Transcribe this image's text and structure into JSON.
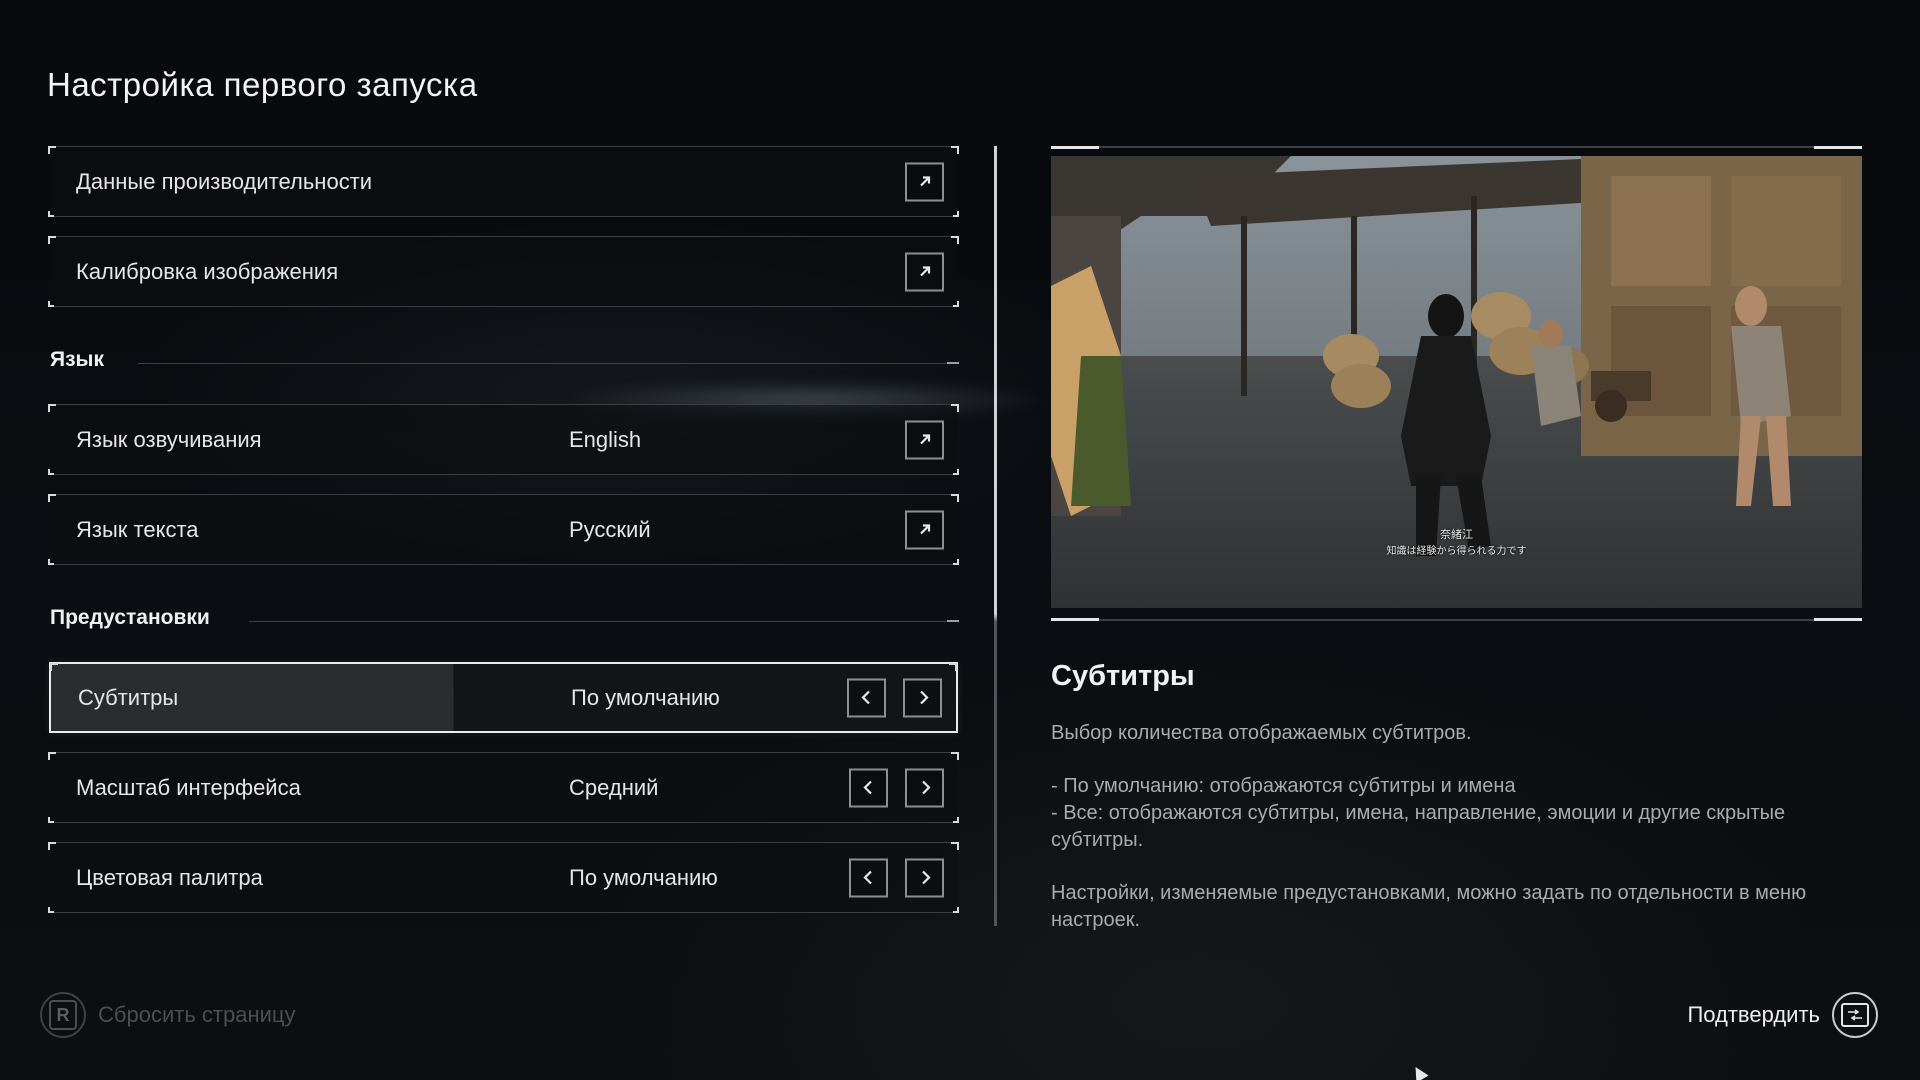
{
  "page": {
    "title": "Настройка первого запуска"
  },
  "rows_top": [
    {
      "label": "Данные производительности",
      "action_icon": "external-arrow-icon"
    },
    {
      "label": "Калибровка изображения",
      "action_icon": "external-arrow-icon"
    }
  ],
  "sections": {
    "language": "Язык",
    "presets": "Предустановки"
  },
  "language_rows": [
    {
      "label": "Язык озвучивания",
      "value": "English",
      "action_icon": "external-arrow-icon"
    },
    {
      "label": "Язык текста",
      "value": "Русский",
      "action_icon": "external-arrow-icon"
    }
  ],
  "preset_rows": [
    {
      "label": "Субтитры",
      "value": "По умолчанию",
      "selected": true
    },
    {
      "label": "Масштаб интерфейса",
      "value": "Средний",
      "selected": false
    },
    {
      "label": "Цветовая палитра",
      "value": "По умолчанию",
      "selected": false
    }
  ],
  "preview": {
    "caption_name": "奈緒江",
    "caption_line": "知識は経験から得られる力です"
  },
  "description": {
    "title": "Субтитры",
    "intro": "Выбор количества отображаемых субтитров.",
    "option_default": "- По умолчанию: отображаются субтитры и имена",
    "option_all": "- Все: отображаются субтитры, имена, направление, эмоции и другие скрытые субтитры.",
    "note": "Настройки, изменяемые предустановками, можно задать по отдельности в меню настроек."
  },
  "footer": {
    "reset_key": "R",
    "reset_label": "Сбросить страницу",
    "confirm_label": "Подтвердить",
    "confirm_icon": "touchpad-icon"
  },
  "colors": {
    "background": "#06080b",
    "text": "#e4e6e8",
    "muted": "#a8acb0",
    "selected_row": "#2a2c2f"
  }
}
